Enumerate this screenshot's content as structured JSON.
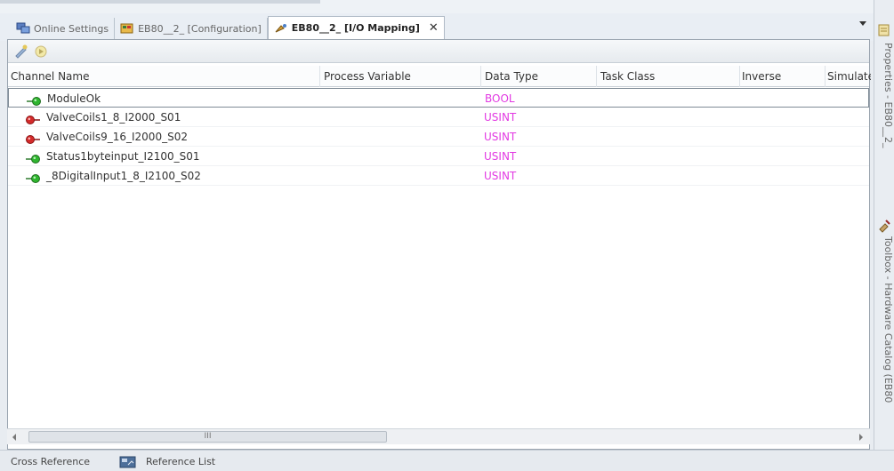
{
  "tabs": [
    {
      "label": "Online Settings",
      "icon": "network-icon",
      "active": false
    },
    {
      "label": "EB80__2_ [Configuration]",
      "icon": "configuration-icon",
      "active": false
    },
    {
      "label": "EB80__2_ [I/O Mapping]",
      "icon": "io-mapping-icon",
      "active": true
    }
  ],
  "tab_close_glyph": "✕",
  "grid": {
    "columns": {
      "channel_name": "Channel Name",
      "process_variable": "Process Variable",
      "data_type": "Data Type",
      "task_class": "Task Class",
      "inverse": "Inverse",
      "simulate": "Simulate"
    },
    "rows": [
      {
        "name": "ModuleOk",
        "data_type": "BOOL",
        "direction": "input",
        "led_color": "#2fb52f"
      },
      {
        "name": "ValveCoils1_8_I2000_S01",
        "data_type": "USINT",
        "direction": "output",
        "led_color": "#d42a2a"
      },
      {
        "name": "ValveCoils9_16_I2000_S02",
        "data_type": "USINT",
        "direction": "output",
        "led_color": "#d42a2a"
      },
      {
        "name": "Status1byteinput_I2100_S01",
        "data_type": "USINT",
        "direction": "input",
        "led_color": "#2fb52f"
      },
      {
        "name": "_8DigitalInput1_8_I2100_S02",
        "data_type": "USINT",
        "direction": "input",
        "led_color": "#2fb52f"
      }
    ]
  },
  "scrollbar_grip": "III",
  "bottom_tabs": [
    {
      "label": "Cross Reference"
    },
    {
      "label": "Reference List",
      "icon": "reference-list-icon"
    }
  ],
  "side_tabs": [
    {
      "label": "Properties - EB80__2_",
      "icon": "properties-icon"
    },
    {
      "label": "Toolbox - Hardware Catalog (EB80",
      "icon": "toolbox-icon"
    }
  ],
  "colors": {
    "data_type_text": "#e23ae2",
    "input_led": "#2fb52f",
    "output_led": "#d42a2a"
  }
}
